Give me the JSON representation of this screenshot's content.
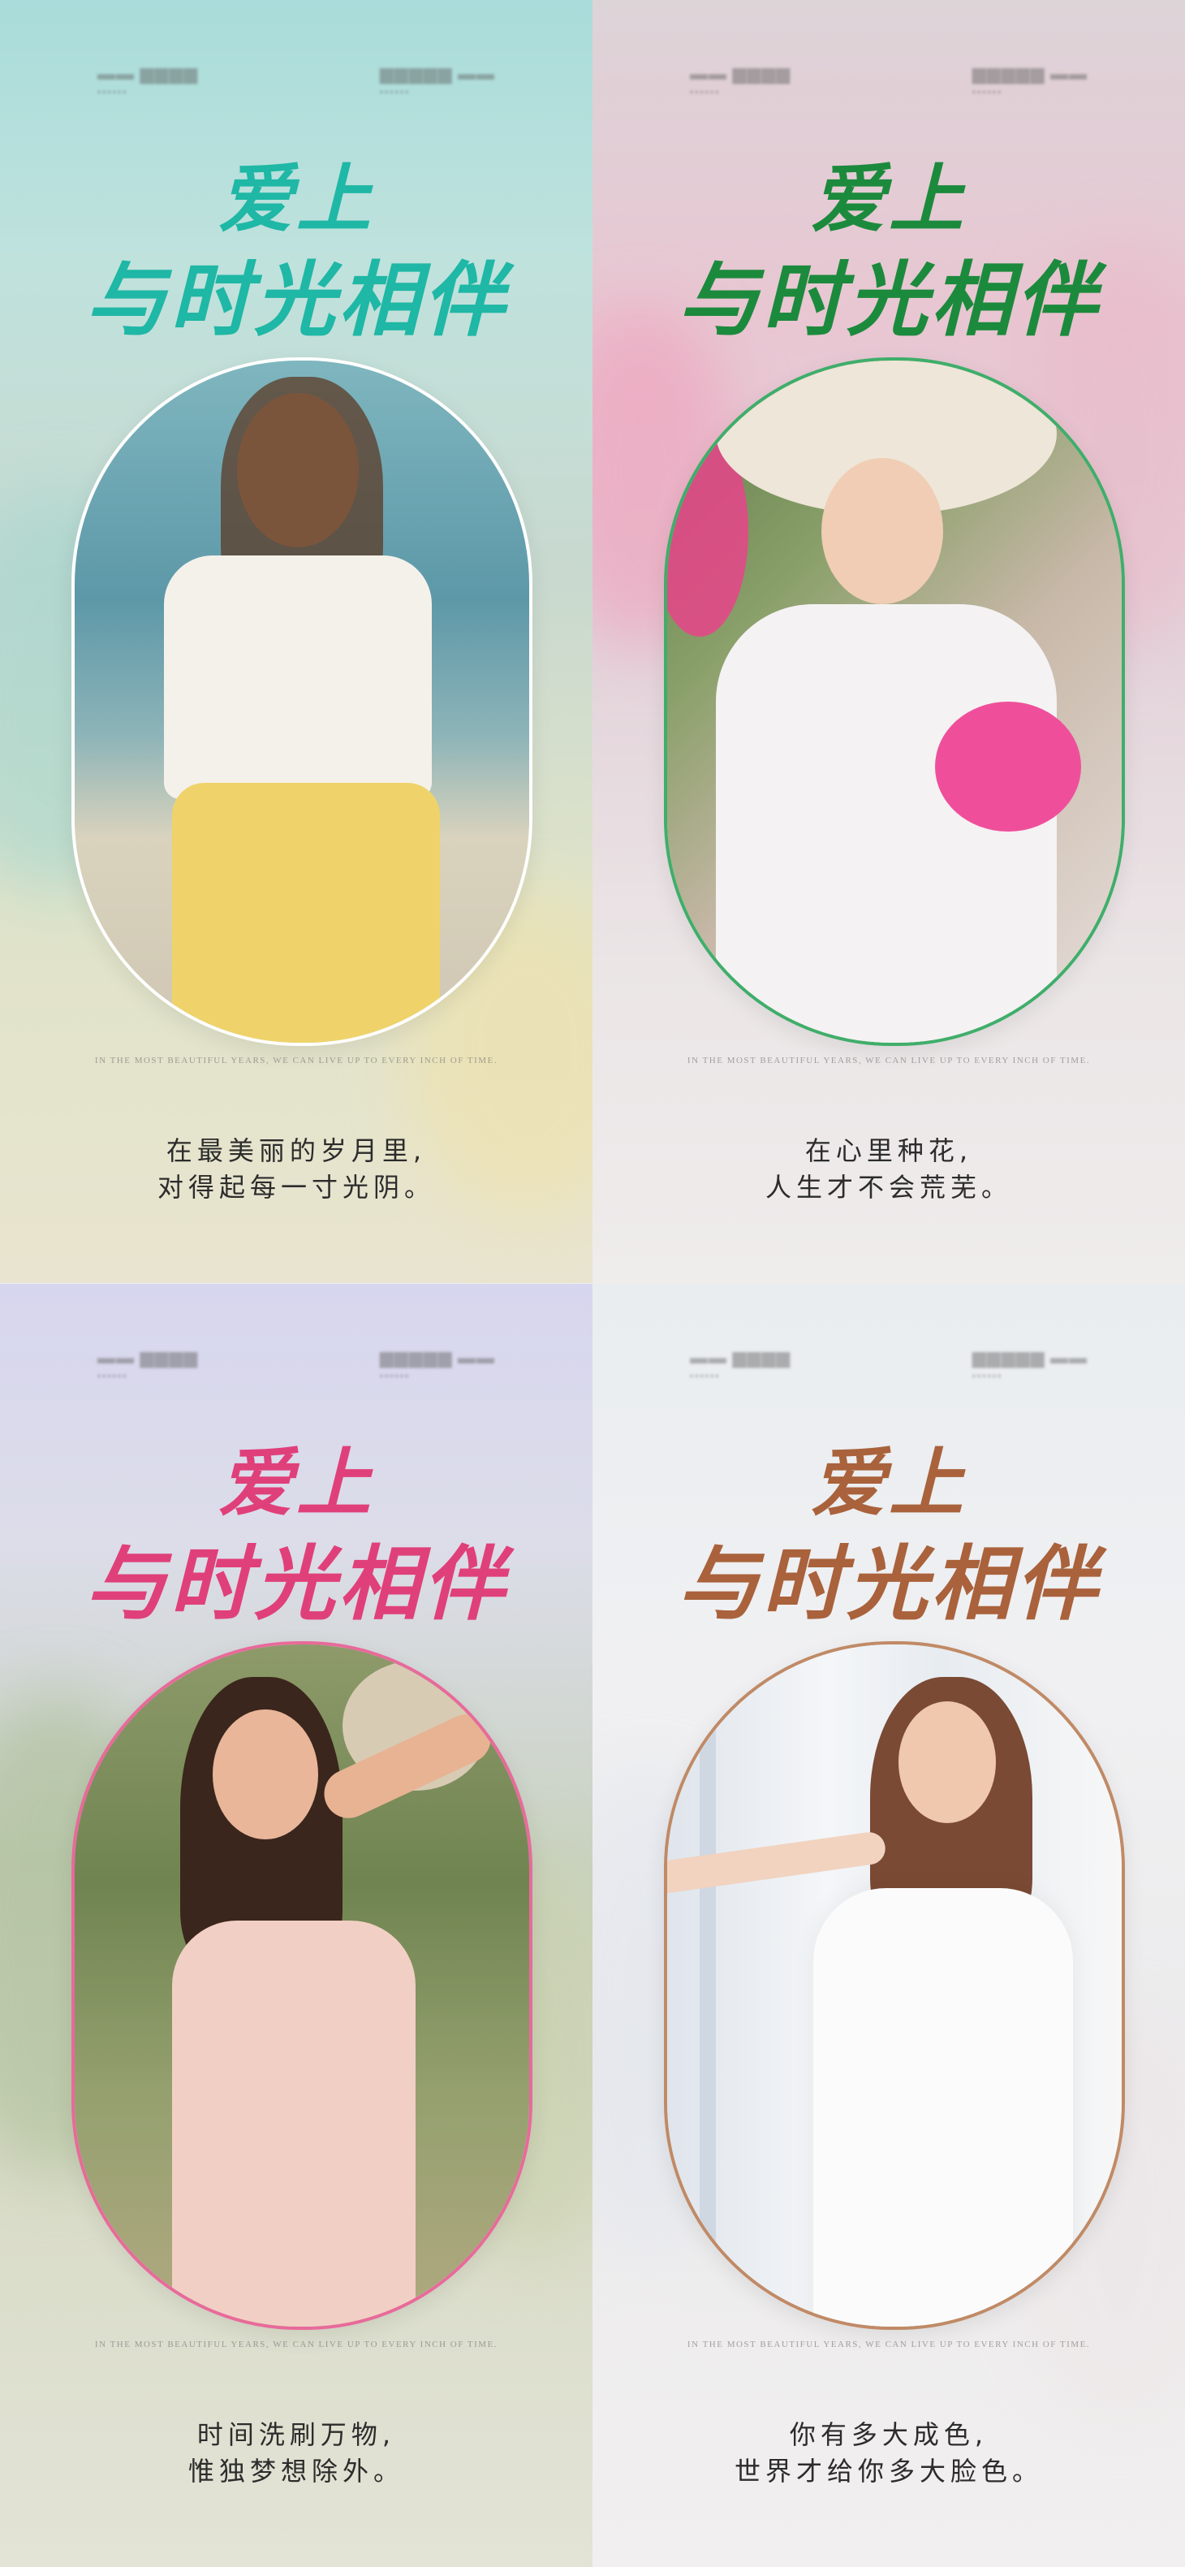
{
  "posters": [
    {
      "title_line1": "爱上",
      "title_line2": "与时光相伴",
      "title_color": "#1fb7a5",
      "tagline": "IN THE MOST BEAUTIFUL YEARS, WE CAN LIVE UP TO EVERY INCH OF TIME.",
      "caption_line1": "在最美丽的岁月里,",
      "caption_line2": "对得起每一寸光阴。",
      "border_color": "#ffffff"
    },
    {
      "title_line1": "爱上",
      "title_line2": "与时光相伴",
      "title_color": "#1c8a3c",
      "tagline": "IN THE MOST BEAUTIFUL YEARS, WE CAN LIVE UP TO EVERY INCH OF TIME.",
      "caption_line1": "在心里种花,",
      "caption_line2": "人生才不会荒芜。",
      "border_color": "#3fae6a"
    },
    {
      "title_line1": "爱上",
      "title_line2": "与时光相伴",
      "title_color": "#e0407a",
      "tagline": "IN THE MOST BEAUTIFUL YEARS, WE CAN LIVE UP TO EVERY INCH OF TIME.",
      "caption_line1": "时间洗刷万物,",
      "caption_line2": "惟独梦想除外。",
      "border_color": "#e86a9a"
    },
    {
      "title_line1": "爱上",
      "title_line2": "与时光相伴",
      "title_color": "#a9623b",
      "tagline": "IN THE MOST BEAUTIFUL YEARS, WE CAN LIVE UP TO EVERY INCH OF TIME.",
      "caption_line1": "你有多大成色,",
      "caption_line2": "世界才给你多大脸色。",
      "border_color": "#c08a66"
    }
  ]
}
